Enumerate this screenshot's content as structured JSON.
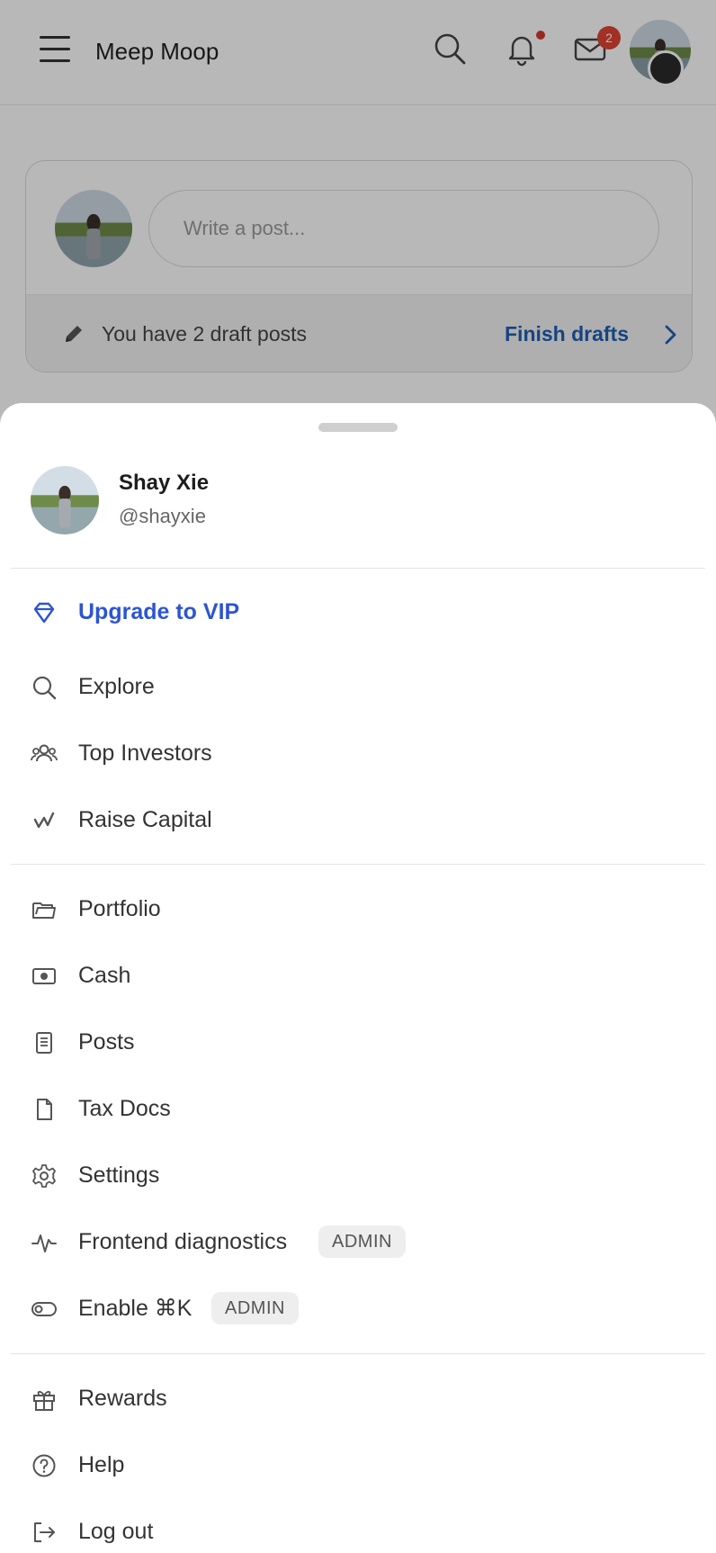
{
  "header": {
    "title": "Meep Moop",
    "messages_badge": "2"
  },
  "composer": {
    "placeholder": "Write a post...",
    "drafts_text": "You have 2 draft posts",
    "finish_drafts": "Finish drafts"
  },
  "profile": {
    "name": "Shay Xie",
    "handle": "@shayxie"
  },
  "menu": {
    "upgrade": "Upgrade to VIP",
    "explore": "Explore",
    "top_investors": "Top Investors",
    "raise_capital": "Raise Capital",
    "portfolio": "Portfolio",
    "cash": "Cash",
    "posts": "Posts",
    "tax_docs": "Tax Docs",
    "settings": "Settings",
    "frontend_diagnostics": "Frontend diagnostics",
    "enable_cmdk": "Enable ⌘K",
    "admin_badge": "ADMIN",
    "rewards": "Rewards",
    "help": "Help",
    "log_out": "Log out"
  },
  "colors": {
    "accent_blue": "#2d55d0",
    "link_blue": "#1f5fb4",
    "badge_red": "#e04432"
  }
}
